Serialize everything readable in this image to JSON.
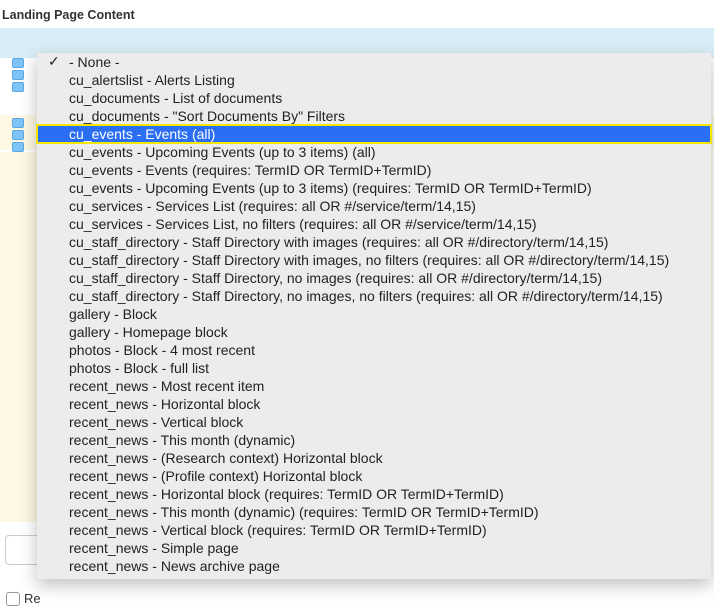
{
  "header": {
    "title": "Landing Page Content"
  },
  "bottom": {
    "checkbox_label": "Re"
  },
  "dropdown": {
    "checked_index": 0,
    "selected_index": 4,
    "items": [
      "- None -",
      "cu_alertslist - Alerts Listing",
      "cu_documents - List of documents",
      "cu_documents - \"Sort Documents By\" Filters",
      "cu_events - Events (all)",
      "cu_events - Upcoming Events (up to 3 items) (all)",
      "cu_events - Events (requires: TermID OR TermID+TermID)",
      "cu_events - Upcoming Events (up to 3 items) (requires: TermID OR TermID+TermID)",
      "cu_services - Services List (requires: all OR #/service/term/14,15)",
      "cu_services - Services List, no filters (requires: all OR #/service/term/14,15)",
      "cu_staff_directory - Staff Directory with images (requires: all OR #/directory/term/14,15)",
      "cu_staff_directory - Staff Directory with images, no filters (requires: all OR #/directory/term/14,15)",
      "cu_staff_directory - Staff Directory, no images (requires: all OR #/directory/term/14,15)",
      "cu_staff_directory - Staff Directory, no images, no filters (requires: all OR #/directory/term/14,15)",
      "gallery - Block",
      "gallery - Homepage block",
      "photos - Block - 4 most recent",
      "photos - Block - full list",
      "recent_news - Most recent item",
      "recent_news - Horizontal block",
      "recent_news - Vertical block",
      "recent_news - This month (dynamic)",
      "recent_news - (Research context) Horizontal block",
      "recent_news - (Profile context) Horizontal block",
      "recent_news - Horizontal block (requires: TermID OR TermID+TermID)",
      "recent_news - This month (dynamic) (requires: TermID OR TermID+TermID)",
      "recent_news - Vertical block (requires: TermID OR TermID+TermID)",
      "recent_news - Simple page",
      "recent_news - News archive page"
    ]
  }
}
